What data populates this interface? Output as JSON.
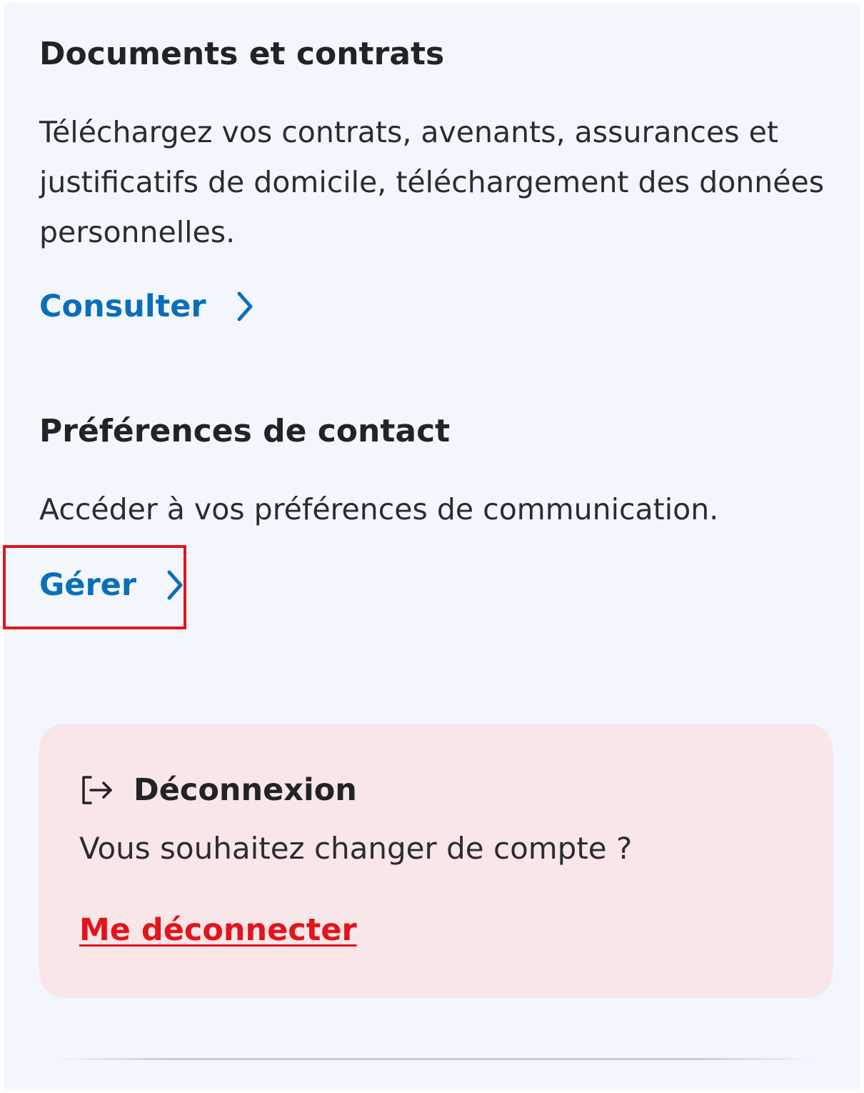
{
  "documents": {
    "title": "Documents et contrats",
    "description": "Téléchargez vos contrats, avenants, assurances et justificatifs de domicile, téléchargement des données personnelles.",
    "link_label": "Consulter",
    "link_icon": "chevron-right-icon"
  },
  "contact_preferences": {
    "title": "Préférences de contact",
    "description": "Accéder à vos préférences de communication.",
    "link_label": "Gérer",
    "link_icon": "chevron-right-icon"
  },
  "logout": {
    "icon": "logout-icon",
    "title": "Déconnexion",
    "description": "Vous souhaitez changer de compte ?",
    "link_label": "Me déconnecter"
  },
  "colors": {
    "link_blue": "#0b6fb8",
    "logout_red": "#e3141b",
    "panel_background": "#f3f7fd",
    "logout_card_background": "#f8e6e8",
    "highlight_border": "#e3141b"
  }
}
